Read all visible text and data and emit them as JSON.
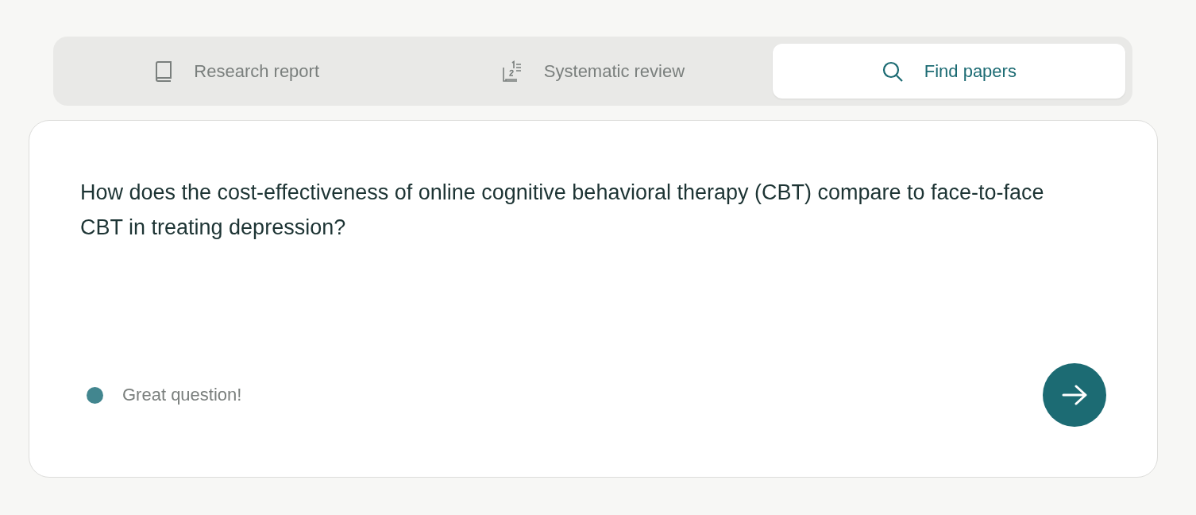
{
  "tabs": [
    {
      "kind": "book",
      "label": "Research report",
      "selected": false
    },
    {
      "kind": "numbered",
      "label": "Systematic review",
      "selected": false
    },
    {
      "kind": "search",
      "label": "Find papers",
      "selected": true
    }
  ],
  "query": {
    "value": "How does the cost-effectiveness of online cognitive behavioral therapy (CBT) compare to face-to-face CBT in treating depression?"
  },
  "status": {
    "text": "Great question!",
    "color": "#42868f"
  }
}
